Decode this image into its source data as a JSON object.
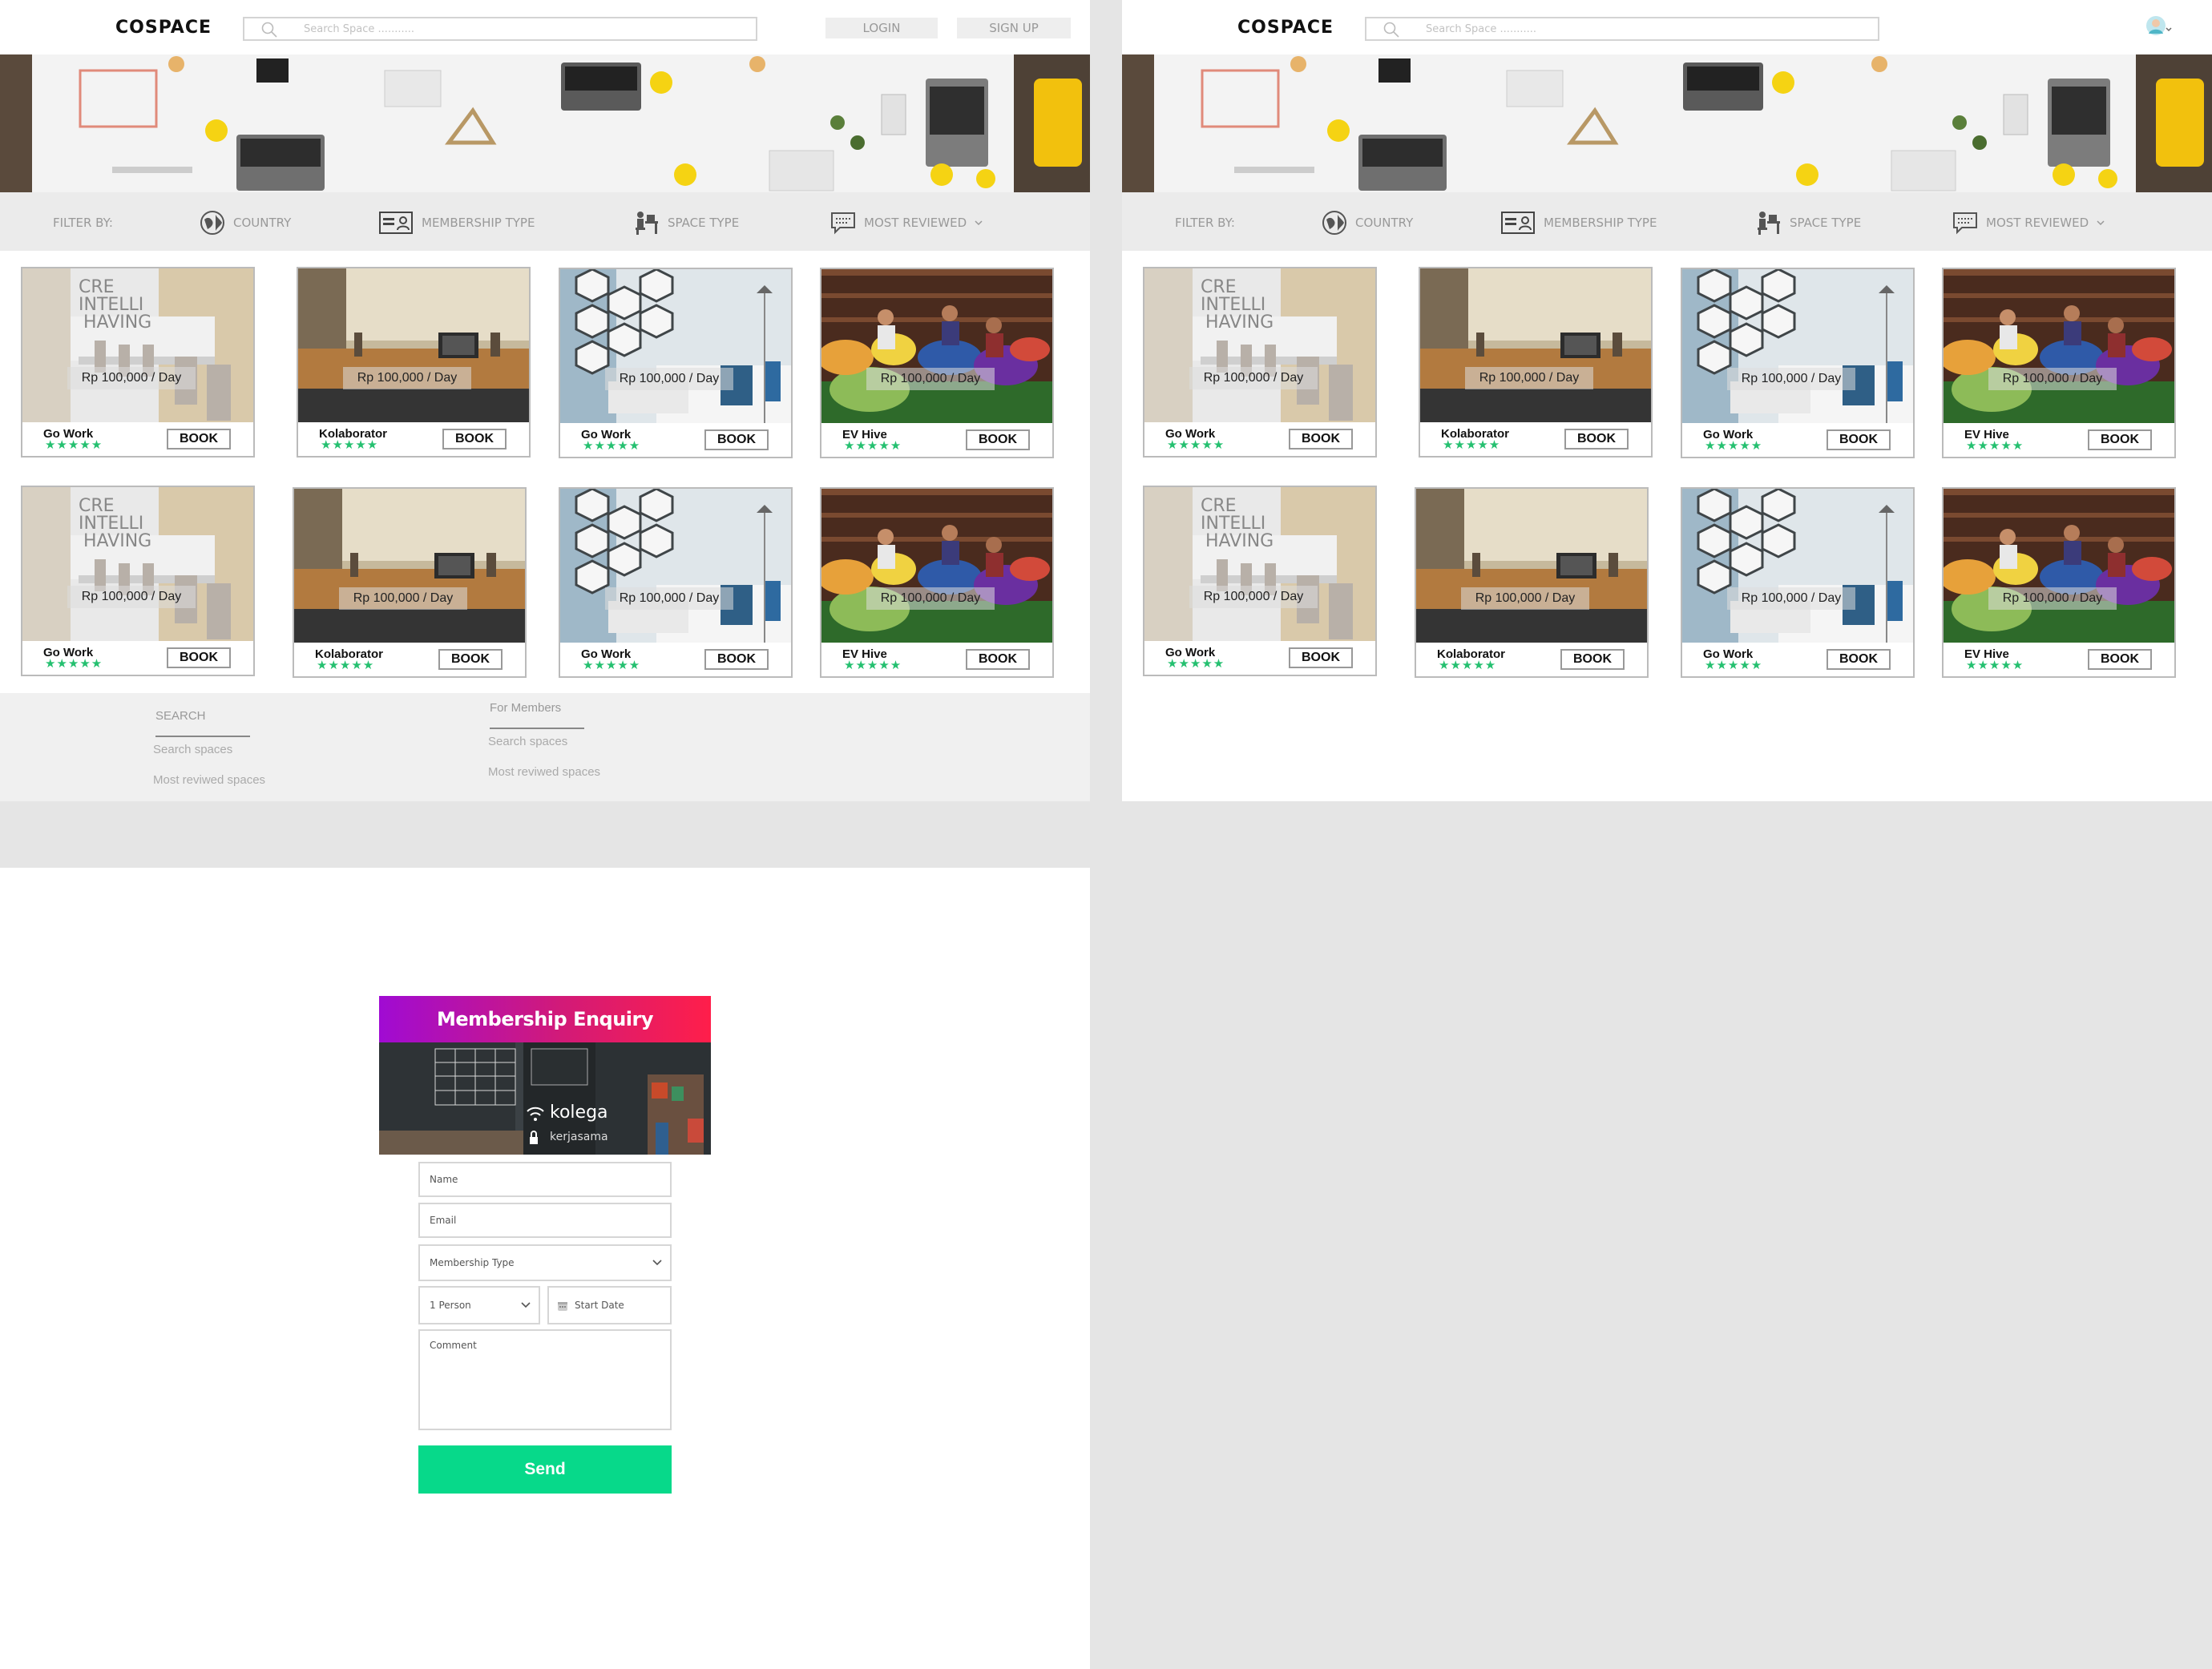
{
  "brand": "COSPACE",
  "search_placeholder": "Search Space ...........",
  "auth": {
    "login": "LOGIN",
    "signup": "SIGN UP"
  },
  "filter": {
    "label": "FILTER BY:",
    "country": "COUNTRY",
    "membership": "MEMBERSHIP TYPE",
    "space_type": "SPACE TYPE",
    "most_reviewed": "MOST REVIEWED"
  },
  "cards": [
    {
      "name": "Go Work",
      "price": "Rp 100,000 / Day",
      "book": "BOOK",
      "stars": "★★★★★"
    },
    {
      "name": "Kolaborator",
      "price": "Rp 100,000 / Day",
      "book": "BOOK",
      "stars": "★★★★★"
    },
    {
      "name": "Go Work",
      "price": "Rp 100,000 / Day",
      "book": "BOOK",
      "stars": "★★★★★"
    },
    {
      "name": "EV Hive",
      "price": "Rp 100,000 / Day",
      "book": "BOOK",
      "stars": "★★★★★"
    },
    {
      "name": "Go Work",
      "price": "Rp 100,000 / Day",
      "book": "BOOK",
      "stars": "★★★★★"
    },
    {
      "name": "Kolaborator",
      "price": "Rp 100,000 / Day",
      "book": "BOOK",
      "stars": "★★★★★"
    },
    {
      "name": "Go Work",
      "price": "Rp 100,000 / Day",
      "book": "BOOK",
      "stars": "★★★★★"
    },
    {
      "name": "EV Hive",
      "price": "Rp 100,000 / Day",
      "book": "BOOK",
      "stars": "★★★★★"
    }
  ],
  "footer": {
    "col1": {
      "title": "SEARCH",
      "links": [
        "Search spaces",
        "Most reviwed spaces"
      ]
    },
    "col2": {
      "title": "For Members",
      "links": [
        "Search spaces",
        "Most reviwed spaces"
      ]
    }
  },
  "enquiry": {
    "title": "Membership Enquiry",
    "image_text": "kolega",
    "image_subtext": "kerjasama",
    "name": "Name",
    "email": "Email",
    "membership_type": "Membership Type",
    "persons": "1 Person",
    "start_date": "Start Date",
    "comment": "Comment",
    "send": "Send"
  },
  "colors": {
    "accent_green": "#07d98a",
    "star_green": "#25c070",
    "gradient_start": "#a00bd3",
    "gradient_end": "#ff1e4a"
  }
}
